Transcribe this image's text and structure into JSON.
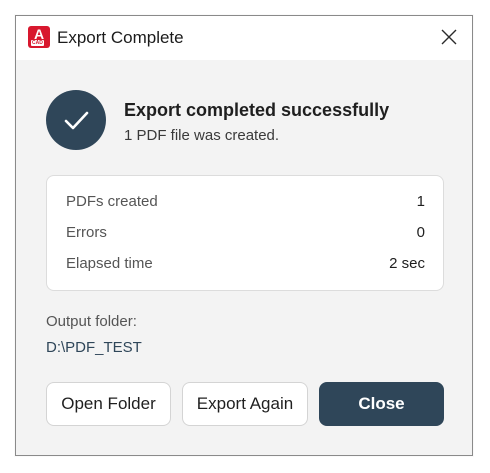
{
  "window": {
    "title": "Export Complete",
    "app_logo_letter": "A",
    "app_logo_sub": "CAD"
  },
  "status": {
    "title": "Export completed successfully",
    "subtitle": "1 PDF file was created."
  },
  "stats": [
    {
      "label": "PDFs created",
      "value": "1"
    },
    {
      "label": "Errors",
      "value": "0"
    },
    {
      "label": "Elapsed time",
      "value": "2 sec"
    }
  ],
  "output": {
    "label": "Output folder:",
    "path": "D:\\PDF_TEST"
  },
  "buttons": {
    "open_folder": "Open Folder",
    "export_again": "Export Again",
    "close": "Close"
  },
  "colors": {
    "accent": "#2f4659",
    "brand": "#d8182e",
    "background": "#f3f3f3"
  },
  "icons": {
    "app": "autocad-logo-icon",
    "close": "close-icon",
    "status": "checkmark-icon"
  }
}
